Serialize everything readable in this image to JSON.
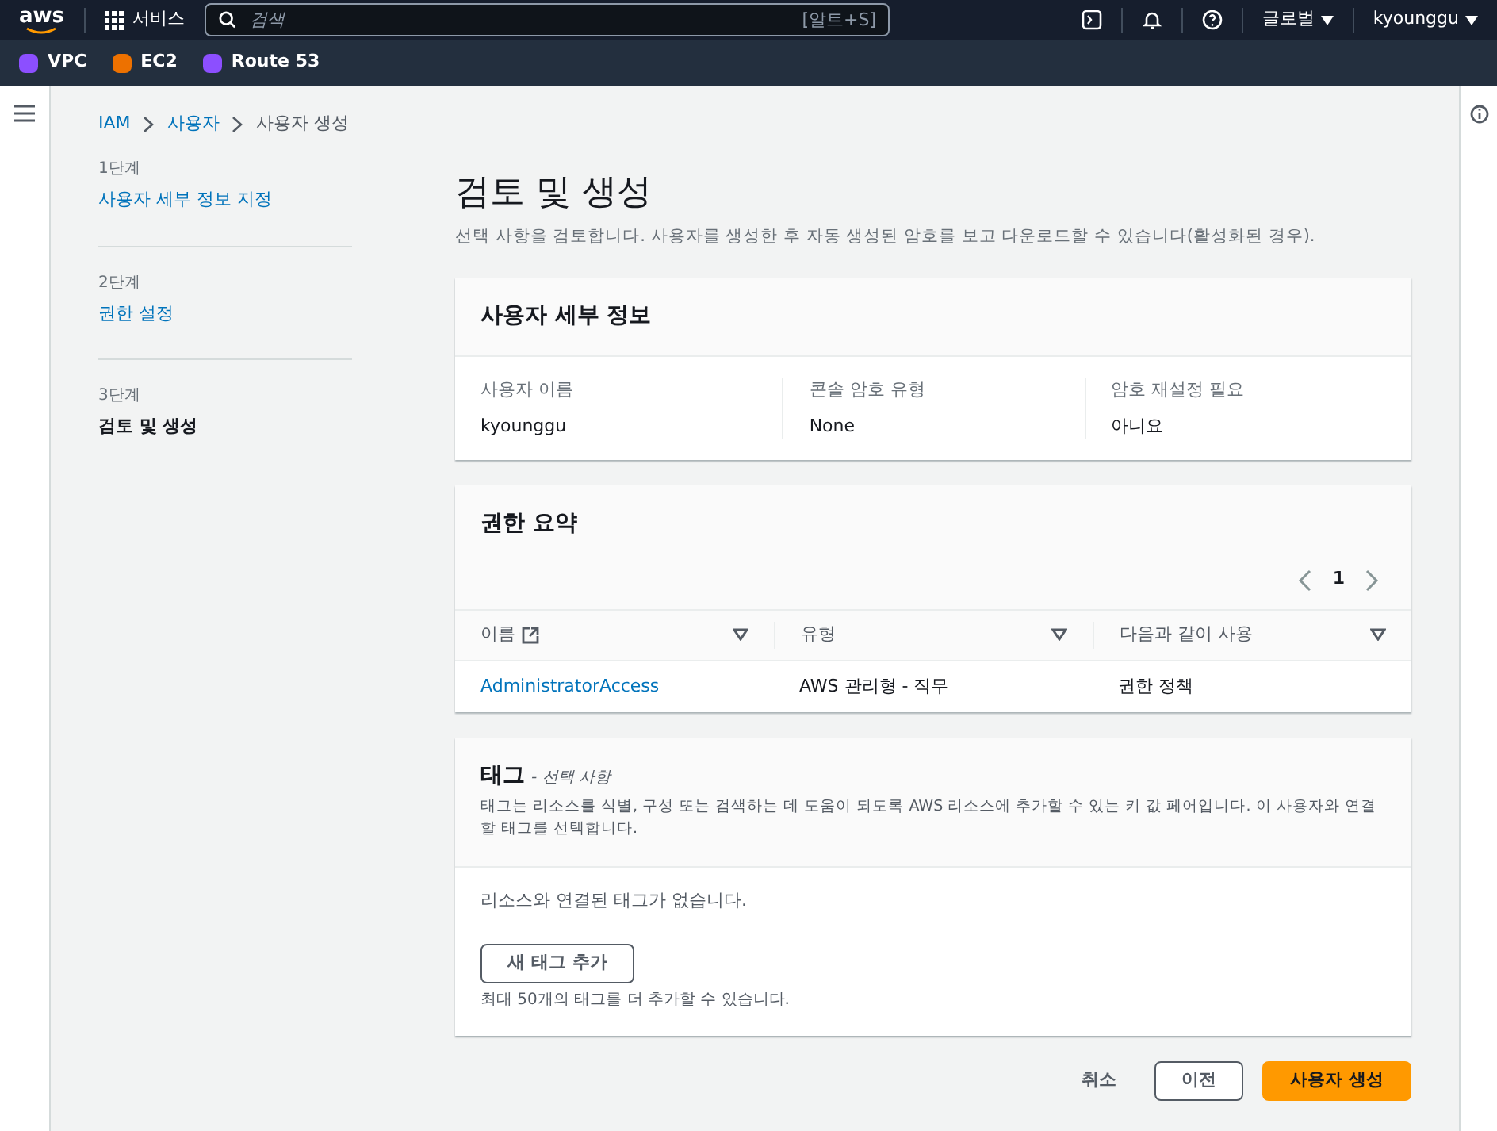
{
  "top_nav": {
    "logo": "aws",
    "services": "서비스",
    "search": {
      "placeholder": "검색",
      "shortcut": "[알트+S]"
    },
    "region": "글로벌",
    "user": "kyounggu"
  },
  "favorites": [
    {
      "label": "VPC",
      "color": "#8c4fff"
    },
    {
      "label": "EC2",
      "color": "#ed7100"
    },
    {
      "label": "Route 53",
      "color": "#8c4fff"
    }
  ],
  "breadcrumbs": [
    {
      "label": "IAM",
      "link": true
    },
    {
      "label": "사용자",
      "link": true
    },
    {
      "label": "사용자 생성",
      "link": false
    }
  ],
  "steps": [
    {
      "number": "1단계",
      "label": "사용자 세부 정보 지정",
      "selected": false
    },
    {
      "number": "2단계",
      "label": "권한 설정",
      "selected": false
    },
    {
      "number": "3단계",
      "label": "검토 및 생성",
      "selected": true
    }
  ],
  "page": {
    "title": "검토 및 생성",
    "description": "선택 사항을 검토합니다. 사용자를 생성한 후 자동 생성된 암호를 보고 다운로드할 수 있습니다(활성화된 경우)."
  },
  "user_details": {
    "title": "사용자 세부 정보",
    "fields": [
      {
        "label": "사용자 이름",
        "value": "kyounggu"
      },
      {
        "label": "콘솔 암호 유형",
        "value": "None"
      },
      {
        "label": "암호 재설정 필요",
        "value": "아니요"
      }
    ]
  },
  "permissions": {
    "title": "권한 요약",
    "page": "1",
    "columns": [
      "이름",
      "유형",
      "다음과 같이 사용"
    ],
    "rows": [
      [
        "AdministratorAccess",
        "AWS 관리형 - 직무",
        "권한 정책"
      ]
    ]
  },
  "tags": {
    "title": "태그",
    "optional": "- 선택 사항",
    "description": "태그는 리소스를 식별, 구성 또는 검색하는 데 도움이 되도록 AWS 리소스에 추가할 수 있는 키 값 페어입니다. 이 사용자와 연결할 태그를 선택합니다.",
    "empty": "리소스와 연결된 태그가 없습니다.",
    "add_button": "새 태그 추가",
    "limit": "최대 50개의 태그를 더 추가할 수 있습니다."
  },
  "actions": {
    "cancel": "취소",
    "previous": "이전",
    "create": "사용자 생성"
  }
}
